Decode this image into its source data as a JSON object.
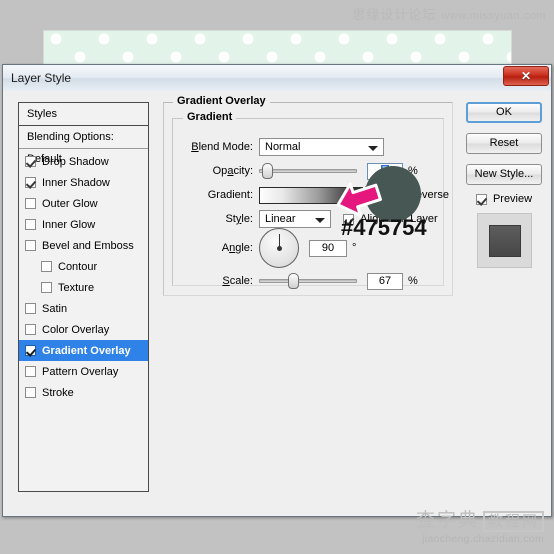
{
  "watermarks": {
    "top_cn": "思缘设计论坛",
    "top_url": "www.missyuan.com",
    "bottom_cn_main": "查字典",
    "bottom_cn_boxed": "教程网",
    "bottom_url": "jiaocheng.chazidian.com"
  },
  "dialog": {
    "title": "Layer Style",
    "close_glyph": "✕"
  },
  "styles_pane": {
    "header": "Styles",
    "blending_options": "Blending Options: Default",
    "effects": [
      {
        "label": "Drop Shadow",
        "checked": true,
        "selected": false,
        "indent": false
      },
      {
        "label": "Inner Shadow",
        "checked": true,
        "selected": false,
        "indent": false
      },
      {
        "label": "Outer Glow",
        "checked": false,
        "selected": false,
        "indent": false
      },
      {
        "label": "Inner Glow",
        "checked": false,
        "selected": false,
        "indent": false
      },
      {
        "label": "Bevel and Emboss",
        "checked": false,
        "selected": false,
        "indent": false
      },
      {
        "label": "Contour",
        "checked": false,
        "selected": false,
        "indent": true
      },
      {
        "label": "Texture",
        "checked": false,
        "selected": false,
        "indent": true
      },
      {
        "label": "Satin",
        "checked": false,
        "selected": false,
        "indent": false
      },
      {
        "label": "Color Overlay",
        "checked": false,
        "selected": false,
        "indent": false
      },
      {
        "label": "Gradient Overlay",
        "checked": true,
        "selected": true,
        "indent": false
      },
      {
        "label": "Pattern Overlay",
        "checked": false,
        "selected": false,
        "indent": false
      },
      {
        "label": "Stroke",
        "checked": false,
        "selected": false,
        "indent": false
      }
    ]
  },
  "settings": {
    "section_title": "Gradient Overlay",
    "group_title": "Gradient",
    "blend_mode_label": "Blend Mode:",
    "blend_mode_value": "Normal",
    "opacity_label": "Opacity:",
    "opacity_value": "7",
    "opacity_unit": "%",
    "gradient_label": "Gradient:",
    "reverse_label": "Reverse",
    "style_label": "Style:",
    "style_value": "Linear",
    "align_label": "Align with Layer",
    "angle_label": "Angle:",
    "angle_value": "90",
    "angle_unit": "°",
    "scale_label": "Scale:",
    "scale_value": "67",
    "scale_unit": "%"
  },
  "buttons": {
    "ok": "OK",
    "reset": "Reset",
    "new_style": "New Style...",
    "preview": "Preview"
  },
  "annotation": {
    "hex_color": "#475754",
    "circle_color": "#475754",
    "arrow_color": "#e5177f"
  }
}
